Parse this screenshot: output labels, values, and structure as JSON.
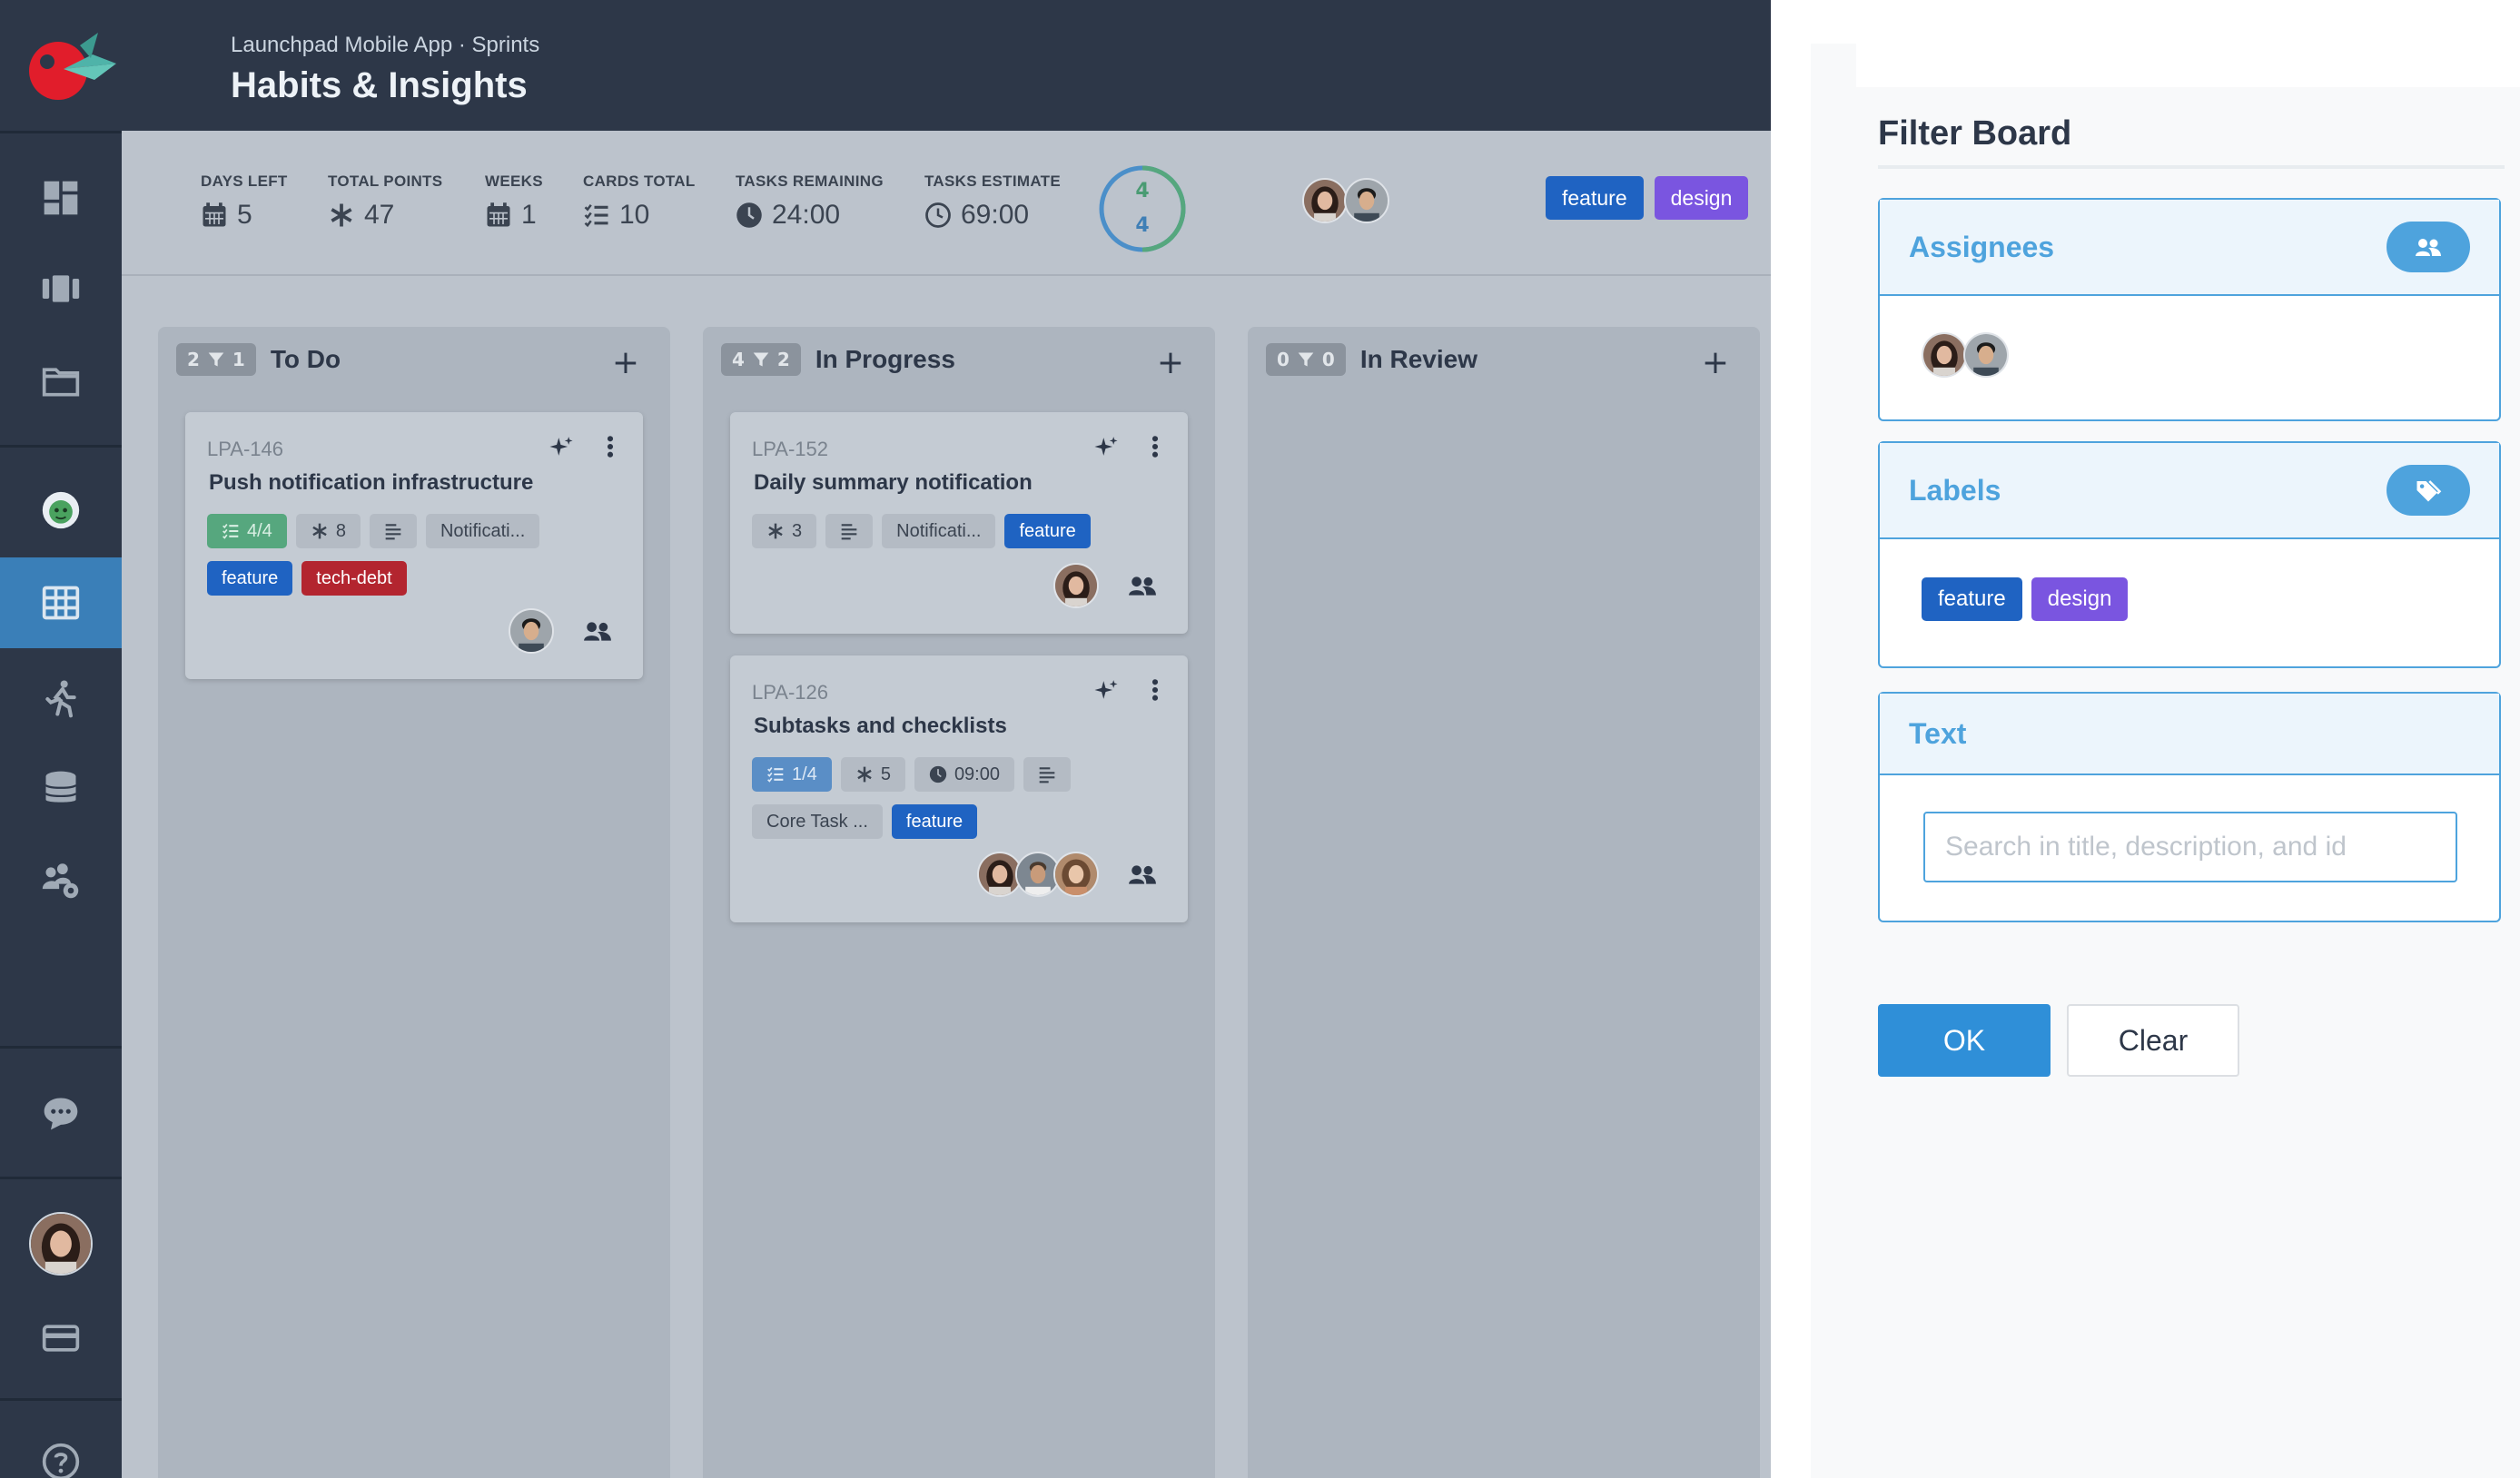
{
  "header": {
    "breadcrumb": "Launchpad Mobile App · Sprints",
    "title": "Habits & Insights"
  },
  "sidebar": {
    "items": [
      {
        "icon": "dashboard-icon"
      },
      {
        "icon": "kanban-icon"
      },
      {
        "icon": "folder-icon"
      },
      {
        "icon": "project-logo-icon"
      },
      {
        "icon": "table-grid-icon",
        "active": true
      },
      {
        "icon": "sprint-runner-icon"
      },
      {
        "icon": "database-icon"
      },
      {
        "icon": "team-settings-icon"
      },
      {
        "icon": "chat-icon"
      },
      {
        "icon": "user-avatar"
      },
      {
        "icon": "billing-card-icon"
      },
      {
        "icon": "help-icon"
      }
    ]
  },
  "stats": {
    "days_left_label": "DAYS LEFT",
    "days_left": "5",
    "total_points_label": "TOTAL POINTS",
    "total_points": "47",
    "weeks_label": "WEEKS",
    "weeks": "1",
    "cards_total_label": "CARDS TOTAL",
    "cards_total": "10",
    "tasks_remaining_label": "TASKS REMAINING",
    "tasks_remaining": "24:00",
    "tasks_estimate_label": "TASKS ESTIMATE",
    "tasks_estimate": "69:00",
    "ring_top": "4",
    "ring_bottom": "4"
  },
  "header_tags": [
    "feature",
    "design"
  ],
  "columns": [
    {
      "title": "To Do",
      "count": "2",
      "filtered": "1",
      "cards": [
        {
          "id": "LPA-146",
          "title": "Push notification infrastructure",
          "checklist": "4/4",
          "points": "8",
          "epic": "Notificati...",
          "tags": [
            "feature",
            "tech-debt"
          ]
        }
      ]
    },
    {
      "title": "In Progress",
      "count": "4",
      "filtered": "2",
      "cards": [
        {
          "id": "LPA-152",
          "title": "Daily summary notification",
          "points": "3",
          "epic": "Notificati...",
          "tags": [
            "feature"
          ]
        },
        {
          "id": "LPA-126",
          "title": "Subtasks and checklists",
          "checklist": "1/4",
          "points": "5",
          "time": "09:00",
          "epic": "Core Task ...",
          "tags": [
            "feature"
          ]
        }
      ]
    },
    {
      "title": "In Review",
      "count": "0",
      "filtered": "0",
      "cards": []
    }
  ],
  "filter": {
    "title": "Filter Board",
    "assignees_title": "Assignees",
    "labels_title": "Labels",
    "labels": [
      "feature",
      "design"
    ],
    "text_title": "Text",
    "search_placeholder": "Search in title, description, and id",
    "ok_label": "OK",
    "clear_label": "Clear"
  },
  "colors": {
    "accent": "#4ea3dd",
    "feature": "#1f63c2",
    "design": "#7a55e0",
    "tech_debt": "#b3252f",
    "sidebar": "#2d3748"
  }
}
